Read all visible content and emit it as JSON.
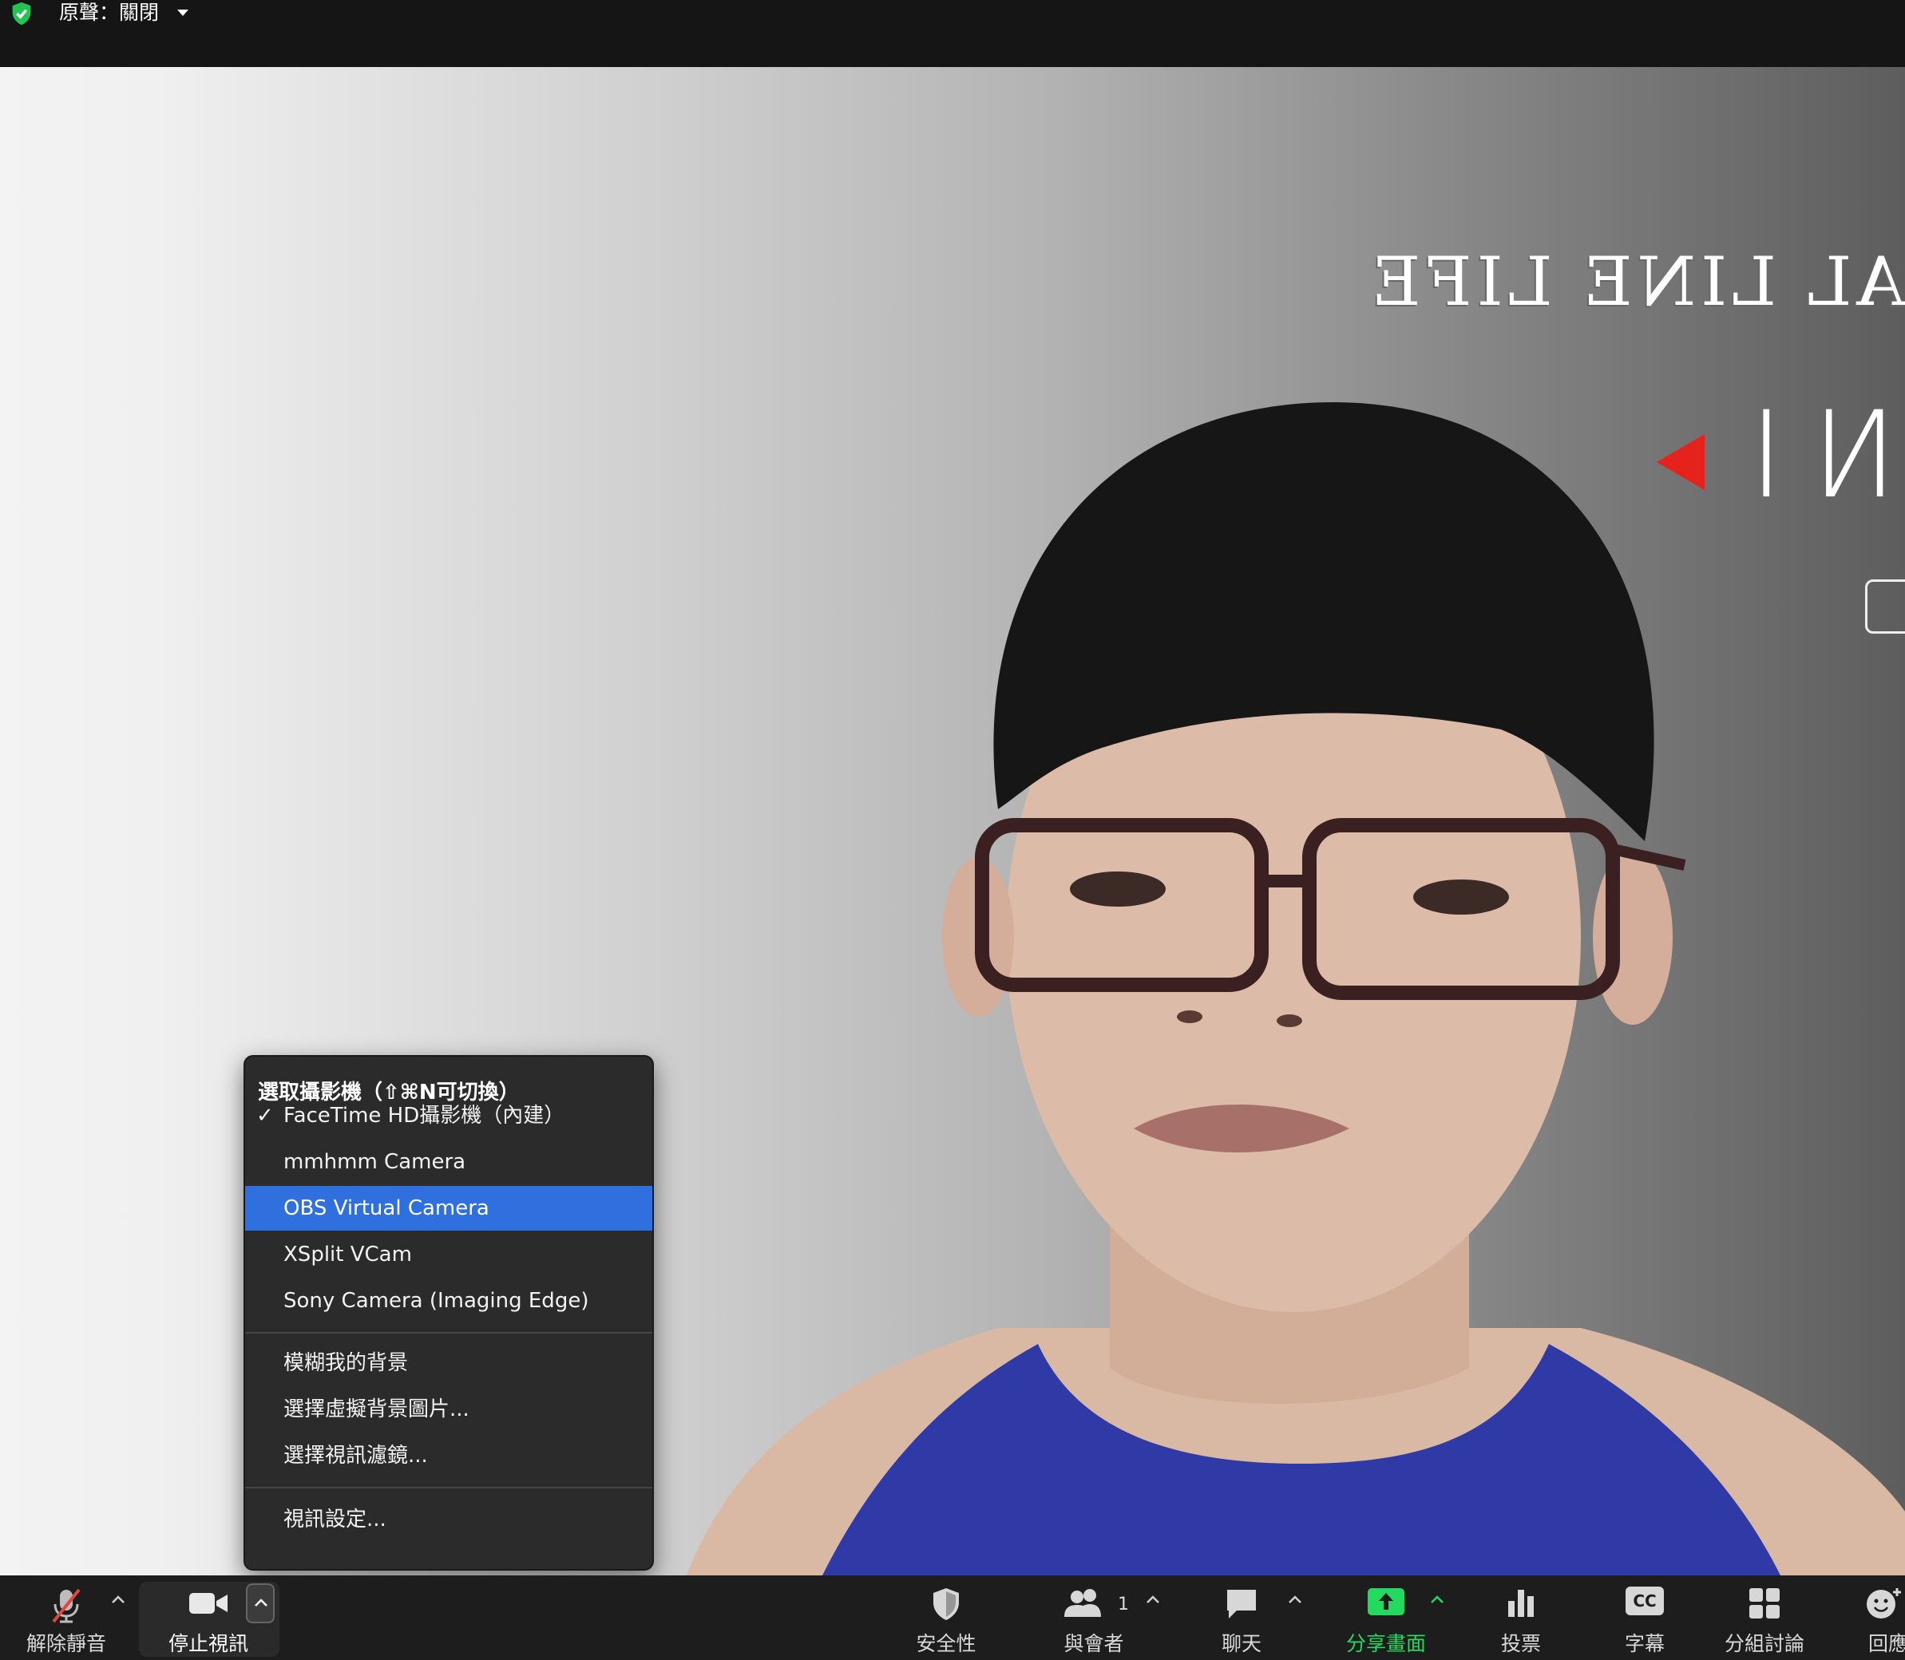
{
  "topbar": {
    "original_sound_label": "原聲：關閉"
  },
  "background_text": {
    "line1": "AL LINE LIFE",
    "line2": "NI"
  },
  "camera_menu": {
    "header": "選取攝影機（⇧⌘N可切換）",
    "check_mark": "✓",
    "cameras": [
      {
        "label": "FaceTime HD攝影機（內建）",
        "checked": true
      },
      {
        "label": "mmhmm Camera",
        "checked": false
      },
      {
        "label": "OBS Virtual Camera",
        "checked": false,
        "highlighted": true
      },
      {
        "label": "XSplit VCam",
        "checked": false
      },
      {
        "label": "Sony Camera (Imaging Edge)",
        "checked": false
      }
    ],
    "background_options": [
      {
        "label": "模糊我的背景"
      },
      {
        "label": "選擇虛擬背景圖片..."
      },
      {
        "label": "選擇視訊濾鏡..."
      }
    ],
    "settings": {
      "label": "視訊設定..."
    }
  },
  "toolbar": {
    "unmute": "解除靜音",
    "stop_video": "停止視訊",
    "security": "安全性",
    "participants": "與會者",
    "participants_count": "1",
    "chat": "聊天",
    "share_screen": "分享畫面",
    "polls": "投票",
    "captions": "字幕",
    "captions_icon_text": "CC",
    "breakout": "分組討論",
    "reactions": "回應"
  },
  "colors": {
    "menu_highlight": "#2f6fde",
    "share_green": "#23d95f",
    "mute_red": "#e0463a"
  }
}
